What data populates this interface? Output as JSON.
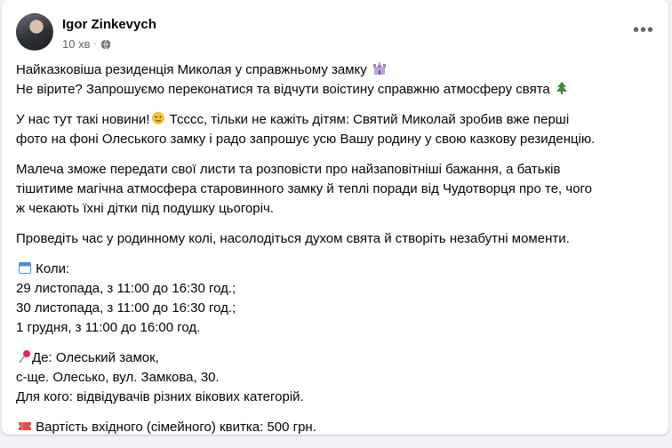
{
  "post": {
    "author": "Igor Zinkevych",
    "time": "10 хв",
    "separator": "·",
    "more_label": "•••"
  },
  "content": {
    "p1_line1": "Найказковіша резиденція Миколая у справжньому замку",
    "p1_line2": "Не вірите? Запрошуємо переконатися та відчути воістину справжню атмосферу свята",
    "p2_line1": "У нас тут такі новини!",
    "p2_line1b": " Тсссс, тільки не кажіть дітям: Святий Миколай зробив вже перші",
    "p2_line2": "фото на фоні Олеського замку і радо запрошує усю Вашу родину у свою казкову резиденцію.",
    "p3_line1": "Малеча зможе передати свої листи та розповісти про найзаповітніші бажання, а батьків",
    "p3_line2": "тішитиме магічна атмосфера старовинного замку й теплі поради від Чудотворця про те, чого",
    "p3_line3": "ж чекають їхні дітки під подушку цьогоріч.",
    "p4_line1": "Проведіть час у родинному колі, насолодіться духом свята й створіть незабутні моменти.",
    "when_label": " Коли:",
    "date1": "29 листопада, з 11:00 до 16:30 год.;",
    "date2": "30 листопада, з 11:00 до 16:30 год.;",
    "date3": "1 грудня, з 11:00 до 16:00 год.",
    "where_label": "Де: Олеський замок,",
    "address": "с-ще. Олесько, вул. Замкова, 30.",
    "audience": "Для кого: відвідувачів різних вікових категорій.",
    "price": " Вартість вхідного (сімейного) квитка: 500 грн."
  }
}
